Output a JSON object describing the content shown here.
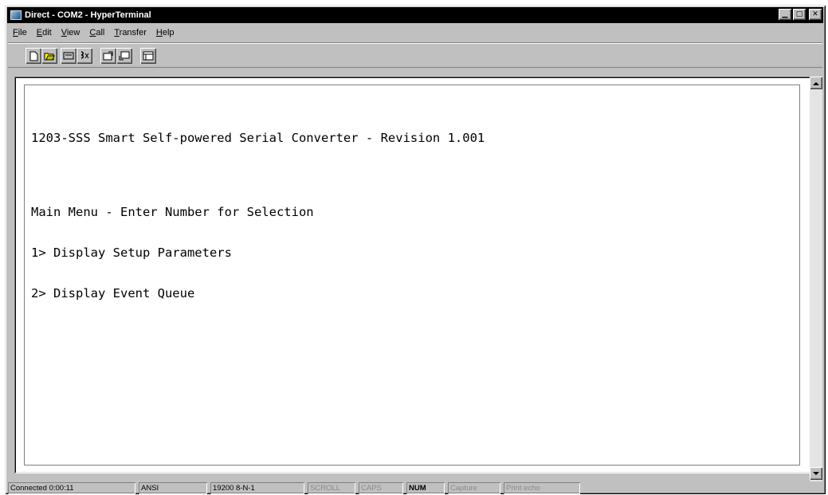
{
  "window": {
    "title": "Direct - COM2 - HyperTerminal",
    "controls": {
      "minimize": "▁",
      "maximize": "□",
      "close": "✕"
    }
  },
  "menu": [
    {
      "first": "F",
      "rest": "ile"
    },
    {
      "first": "E",
      "rest": "dit"
    },
    {
      "first": "V",
      "rest": "iew"
    },
    {
      "first": "C",
      "rest": "all"
    },
    {
      "first": "T",
      "rest": "ransfer"
    },
    {
      "first": "H",
      "rest": "elp"
    }
  ],
  "toolbar": {
    "buttons": [
      "new-icon",
      "open-icon",
      "connect-icon",
      "disconnect-icon",
      "send-icon",
      "receive-icon",
      "properties-icon"
    ]
  },
  "terminal": {
    "lines": [
      "1203-SSS Smart Self-powered Serial Converter - Revision 1.001",
      "",
      "Main Menu - Enter Number for Selection",
      "1> Display Setup Parameters",
      "2> Display Event Queue"
    ]
  },
  "status": {
    "connected": "Connected 0:00:11",
    "emulation": "ANSI",
    "port_settings": "19200 8-N-1",
    "scroll": "SCROLL",
    "caps": "CAPS",
    "num": "NUM",
    "capture": "Capture",
    "print_echo": "Print echo"
  }
}
